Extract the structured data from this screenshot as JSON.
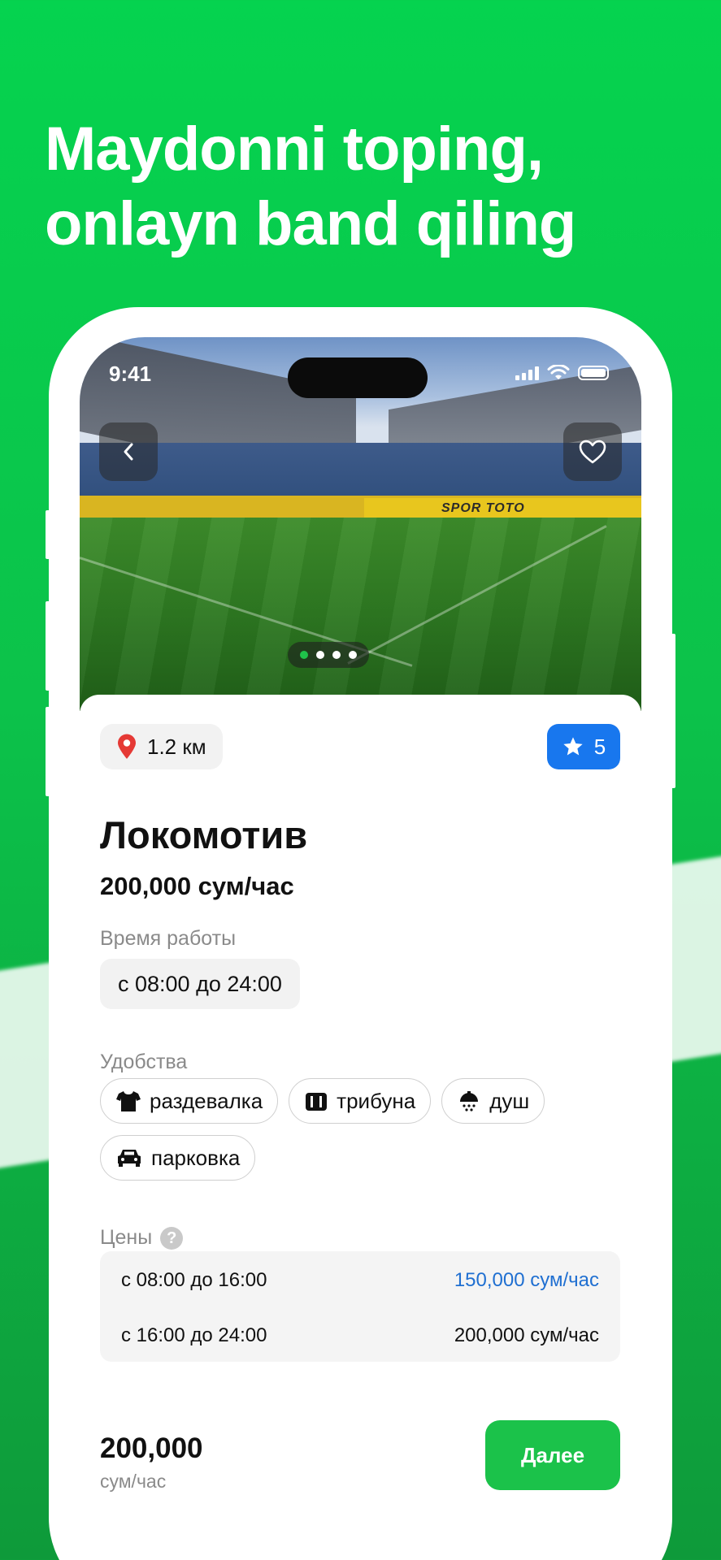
{
  "headline": {
    "line1": "Maydonni toping,",
    "line2": "onlayn band qiling"
  },
  "status_bar": {
    "time": "9:41"
  },
  "photo": {
    "sponsor": "SPOR TOTO",
    "carousel": {
      "pages": 4,
      "active_index": 0
    }
  },
  "venue": {
    "distance": "1.2 км",
    "rating": "5",
    "name": "Локомотив",
    "price": "200,000 сум/час"
  },
  "hours": {
    "label": "Время работы",
    "value": "с 08:00 до 24:00"
  },
  "amenities": {
    "label": "Удобства",
    "items": [
      {
        "icon": "tshirt-icon",
        "label": "раздевалка"
      },
      {
        "icon": "stand-icon",
        "label": "трибуна"
      },
      {
        "icon": "shower-icon",
        "label": "душ"
      },
      {
        "icon": "car-icon",
        "label": "парковка"
      }
    ]
  },
  "prices": {
    "label": "Цены",
    "rows": [
      {
        "time": "с 08:00 до 16:00",
        "value": "150,000 сум/час",
        "color": "#1f6fd1"
      },
      {
        "time": "с 16:00 до 24:00",
        "value": "200,000 сум/час",
        "color": "#111111"
      }
    ]
  },
  "footer": {
    "price": "200,000",
    "unit": "сум/час",
    "next_label": "Далее"
  },
  "colors": {
    "brand_green": "#1bc24a",
    "rating_blue": "#1877ee",
    "pin_red": "#e53935"
  }
}
